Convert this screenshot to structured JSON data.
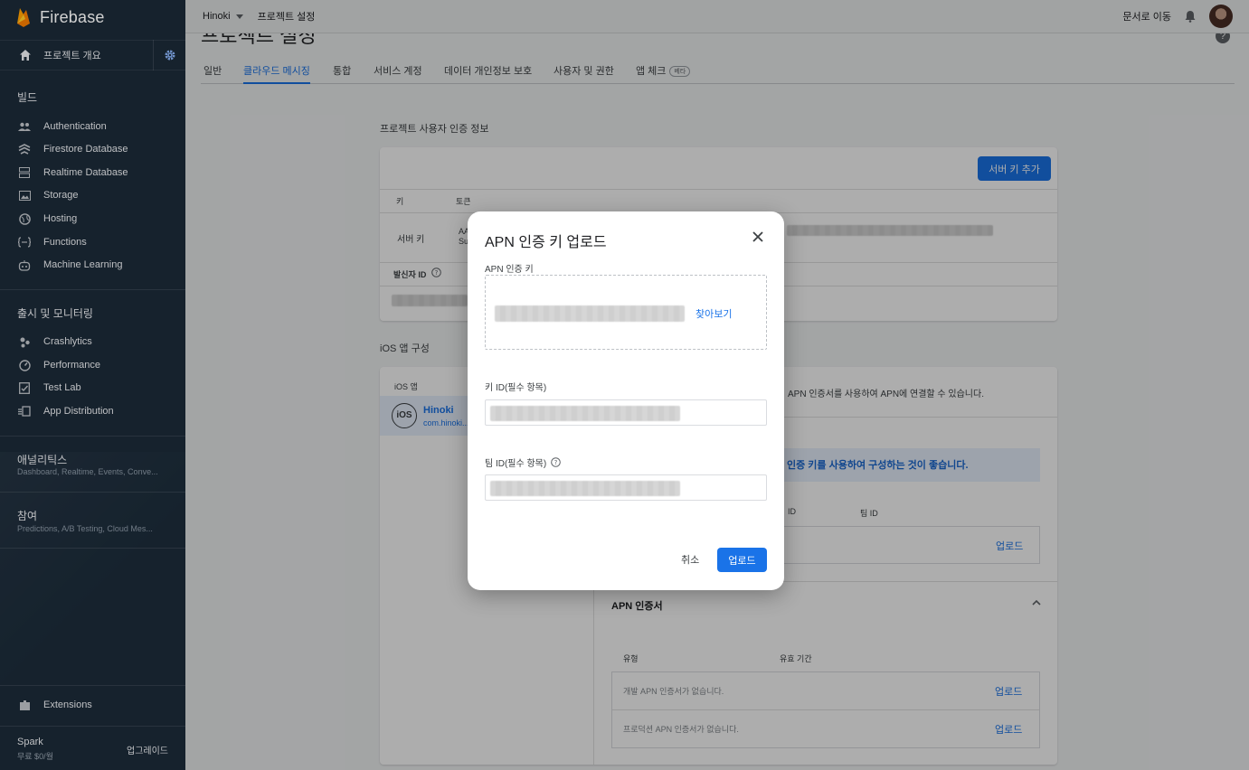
{
  "app": {
    "name": "Firebase"
  },
  "sidebar": {
    "overview": "프로젝트 개요",
    "build_title": "빌드",
    "build_items": [
      {
        "label": "Authentication",
        "icon": "people-icon"
      },
      {
        "label": "Firestore Database",
        "icon": "firestore-icon"
      },
      {
        "label": "Realtime Database",
        "icon": "database-icon"
      },
      {
        "label": "Storage",
        "icon": "image-icon"
      },
      {
        "label": "Hosting",
        "icon": "globe-icon"
      },
      {
        "label": "Functions",
        "icon": "functions-icon"
      },
      {
        "label": "Machine Learning",
        "icon": "robot-icon"
      }
    ],
    "release_title": "출시 및 모니터링",
    "release_items": [
      {
        "label": "Crashlytics",
        "icon": "crashlytics-icon"
      },
      {
        "label": "Performance",
        "icon": "speedometer-icon"
      },
      {
        "label": "Test Lab",
        "icon": "checklist-icon"
      },
      {
        "label": "App Distribution",
        "icon": "distribution-icon"
      }
    ],
    "analytics_title": "애널리틱스",
    "analytics_sub": "Dashboard, Realtime, Events, Conve...",
    "engage_title": "참여",
    "engage_sub": "Predictions, A/B Testing, Cloud Mes...",
    "extensions": "Extensions",
    "plan_name": "Spark",
    "plan_price": "무료 $0/월",
    "upgrade": "업그레이드"
  },
  "topbar": {
    "project": "Hinoki",
    "crumb": "프로젝트 설정",
    "docs": "문서로 이동"
  },
  "page": {
    "title": "프로젝트 설정",
    "tabs": [
      "일반",
      "클라우드 메시징",
      "통합",
      "서비스 계정",
      "데이터 개인정보 보호",
      "사용자 및 권한",
      "앱 체크"
    ],
    "beta": "베타",
    "active_tab": "클라우드 메시징"
  },
  "credentials": {
    "section": "프로젝트 사용자 인증 정보",
    "add_server_key": "서버 키 추가",
    "col_key": "키",
    "col_token": "토큰",
    "server_key": "서버 키",
    "token_prefix": "AA\nSu",
    "sender_id": "발신자 ID"
  },
  "ios": {
    "section": "iOS 앱 구성",
    "col_app": "iOS 앱",
    "app_name": "Hinoki",
    "bundle": "com.hinoki...",
    "badge": "iOS",
    "desc": "APN 인증서를 사용하여 APN에 연결할 수 있습니다.",
    "recommend": "인증 키를 사용하여 구성하는 것이 좋습니다.",
    "col_key_id": "ID",
    "col_team_id": "팀 ID",
    "upload": "업로드",
    "apn_cert_title": "APN 인증서",
    "col_type": "유형",
    "col_expiry": "유효 기간",
    "dev_cert": "개발 APN 인증서가 없습니다.",
    "prod_cert": "프로덕션 APN 인증서가 없습니다."
  },
  "dialog": {
    "title": "APN 인증 키 업로드",
    "apn_key_label": "APN 인증 키",
    "browse": "찾아보기",
    "key_id_label": "키 ID(필수 항목)",
    "team_id_label": "팀 ID(필수 항목)",
    "cancel": "취소",
    "upload": "업로드"
  },
  "colors": {
    "accent": "#1a73e8",
    "sidebar": "#1b2a38"
  }
}
